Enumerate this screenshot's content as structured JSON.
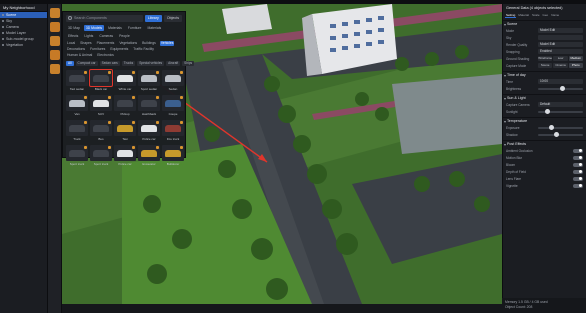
{
  "app": {
    "window_title": "My Neighborhood",
    "notice": "Saved automatically"
  },
  "outliner": {
    "header": "My Neighborhood",
    "items": [
      {
        "label": "Scene",
        "selected": true
      },
      {
        "label": "Sky",
        "selected": false
      },
      {
        "label": "Camera",
        "selected": false
      },
      {
        "label": "Model Layer",
        "selected": false
      },
      {
        "label": "Sub-model group",
        "selected": false
      },
      {
        "label": "Vegetation",
        "selected": false
      }
    ]
  },
  "tools": [
    "edit-icon",
    "library-icon",
    "terrain-icon",
    "paint-icon",
    "sky-icon"
  ],
  "library": {
    "search_placeholder": "Search Components",
    "library_button": "Library",
    "objects_button": "Objects",
    "tabs": [
      {
        "label": "3D Map",
        "active": false
      },
      {
        "label": "3D Models",
        "active": true
      },
      {
        "label": "Materials",
        "active": false
      },
      {
        "label": "Furniture",
        "active": false
      },
      {
        "label": "Materials",
        "active": false
      }
    ],
    "tabs2": [
      {
        "label": "Effects",
        "active": false
      },
      {
        "label": "Lights",
        "active": false
      },
      {
        "label": "Cameras",
        "active": false
      },
      {
        "label": "People",
        "active": false
      }
    ],
    "categories": [
      {
        "label": "Local",
        "active": false
      },
      {
        "label": "Shapes",
        "active": false
      },
      {
        "label": "Placements",
        "active": false
      },
      {
        "label": "Vegetations",
        "active": false
      },
      {
        "label": "Buildings",
        "active": false
      },
      {
        "label": "Vehicles",
        "active": true
      },
      {
        "label": "Decorations",
        "active": false
      },
      {
        "label": "Furnitures",
        "active": false
      },
      {
        "label": "Equipments",
        "active": false
      },
      {
        "label": "Traffic Facility",
        "active": false
      },
      {
        "label": "Human & Animal",
        "active": false
      },
      {
        "label": "Electronics",
        "active": false
      }
    ],
    "subfilters": [
      {
        "label": "All",
        "active": true
      },
      {
        "label": "Compact car",
        "active": false
      },
      {
        "label": "Sedan cars",
        "active": false
      },
      {
        "label": "Trucks",
        "active": false
      },
      {
        "label": "Special vehicles",
        "active": false
      },
      {
        "label": "Aircraft",
        "active": false
      },
      {
        "label": "Ships",
        "active": false
      }
    ],
    "items": [
      {
        "label": "Taxi sedan",
        "color": "dark",
        "highlight": false
      },
      {
        "label": "Black car",
        "color": "dark",
        "highlight": true
      },
      {
        "label": "White car",
        "color": "white",
        "highlight": false
      },
      {
        "label": "Sport sedan",
        "color": "light",
        "highlight": false
      },
      {
        "label": "Sedan",
        "color": "light",
        "highlight": false
      },
      {
        "label": "Van",
        "color": "light",
        "highlight": false
      },
      {
        "label": "SUV",
        "color": "white",
        "highlight": false
      },
      {
        "label": "Pickup",
        "color": "dark",
        "highlight": false
      },
      {
        "label": "Hatchback",
        "color": "dark",
        "highlight": false
      },
      {
        "label": "Coupe",
        "color": "blue",
        "highlight": false
      },
      {
        "label": "Truck",
        "color": "dark",
        "highlight": false
      },
      {
        "label": "Bus",
        "color": "dark",
        "highlight": false
      },
      {
        "label": "Taxi",
        "color": "yellow",
        "highlight": false
      },
      {
        "label": "Police car",
        "color": "white",
        "highlight": false
      },
      {
        "label": "Fire truck",
        "color": "red",
        "highlight": false
      },
      {
        "label": "Sport truck",
        "color": "dark",
        "highlight": false
      },
      {
        "label": "Sport truck",
        "color": "dark",
        "highlight": false
      },
      {
        "label": "Police car",
        "color": "white",
        "highlight": false
      },
      {
        "label": "Excavator",
        "color": "yellow",
        "highlight": false
      },
      {
        "label": "Bulldozer",
        "color": "yellow",
        "highlight": false
      }
    ]
  },
  "properties": {
    "title": "General Data (4 objects selected)",
    "tabs": [
      {
        "label": "Setting",
        "active": true
      },
      {
        "label": "Material",
        "active": false
      },
      {
        "label": "Scale",
        "active": false
      },
      {
        "label": "Geo",
        "active": false
      },
      {
        "label": "Name",
        "active": false
      }
    ],
    "sections": {
      "scene": "Scene",
      "time": "Time of day",
      "sun": "Sun & Light",
      "temp": "Temperature",
      "post": "Post Effects"
    },
    "rows": {
      "model": {
        "label": "Mode",
        "value": "Model Edit"
      },
      "sky": {
        "label": "Sky",
        "value": ""
      },
      "quality": {
        "label": "Render Quality",
        "value": "Model Edit"
      },
      "snap": {
        "label": "Snapping",
        "value": "Enabled"
      },
      "ground": {
        "label": "Ground Shading",
        "options": [
          "Wireframe",
          "Low",
          "Medium"
        ],
        "selected": 2
      },
      "mode": {
        "label": "Capture Mode",
        "options": [
          "Scene",
          "Cinema",
          "Photo"
        ],
        "selected": 2
      },
      "hour": {
        "label": "Time",
        "value": "10:00"
      },
      "camera": {
        "label": "Capture Camera",
        "value": "Default"
      },
      "bright": {
        "label": "Brightness",
        "value": 0.55
      },
      "sunlight": {
        "label": "Sunlight",
        "value": 0.2
      },
      "exposure": {
        "label": "Exposure",
        "value": 0.3
      },
      "shadow": {
        "label": "Shadow",
        "value": 0.4
      }
    },
    "toggles": [
      "Ambient Occlusion",
      "Motion Blur",
      "Bloom",
      "Depth of Field",
      "Lens Flare",
      "Vignette"
    ]
  },
  "statusbar": {
    "line1": "Memory 1.5 GB / 4 GB used",
    "line2": "Object Count: 208"
  },
  "colors": {
    "accent": "#2f6fd6",
    "selection_highlight": "#e0352b",
    "tool_orange": "#c8812c",
    "notice_green": "#1f6a2c"
  }
}
